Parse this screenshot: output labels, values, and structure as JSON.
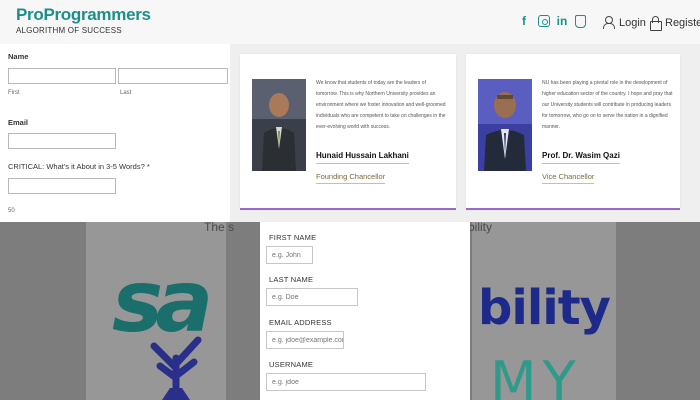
{
  "header": {
    "logo_title": "ProProgrammers",
    "logo_tagline": "ALGORITHM OF SUCCESS",
    "social": [
      "facebook-icon",
      "instagram-icon",
      "linkedin-icon",
      "badge-icon"
    ],
    "social_in_text": "in",
    "social_fb_text": "f",
    "login_label": "Login",
    "register_label": "Register"
  },
  "bg_form": {
    "name_label": "Name",
    "first_sub": "First",
    "last_sub": "Last",
    "email_label": "Email",
    "critical_label": "CRITICAL: What's it About in 3-5 Words? *",
    "counter": "50"
  },
  "cards": [
    {
      "description": "We know that students of today are the leaders of tomorrow. This is why Northern University provides an environment where we foster innovation and well-groomed individuals who are competent to take on challenges in the ever-evolving world with success.",
      "name": "Hunaid Hussain Lakhani",
      "role": "Founding Chancellor"
    },
    {
      "description": "NU has been playing a pivotal role in the development of higher education sector of the country. I hope and pray that our University students will contribute in producing leaders for tomorrow, who go on to serve the nation in a dignified manner.",
      "name": "Prof. Dr. Wasim Qazi",
      "role": "Vice Chancellor"
    }
  ],
  "background": {
    "faded_left": "The s",
    "faded_right": "bility",
    "logo_left": "sa",
    "logo_right_top": "bility",
    "logo_right_bottom": "MY"
  },
  "registration": {
    "first_name_label": "FIRST NAME",
    "first_name_placeholder": "e.g. John",
    "last_name_label": "LAST NAME",
    "last_name_placeholder": "e.g. Doe",
    "email_label": "EMAIL ADDRESS",
    "email_placeholder": "e.g. jdoe@example.com",
    "username_label": "USERNAME",
    "username_placeholder": "e.g. jdoe"
  },
  "colors": {
    "brand_teal": "#1c8f8a",
    "card_accent": "#9a6ac8",
    "background_band": "#7d7d7d"
  }
}
